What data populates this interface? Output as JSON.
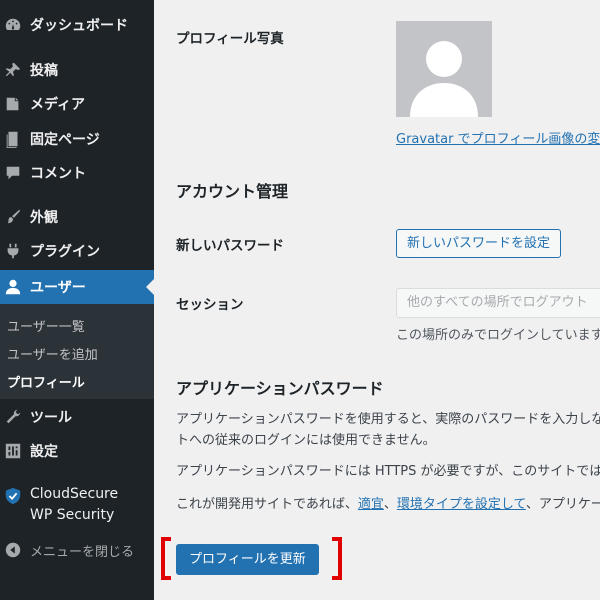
{
  "sidebar": {
    "items": [
      {
        "label": "ダッシュボード",
        "icon": "dashboard-icon"
      },
      {
        "label": "投稿",
        "icon": "pin-icon"
      },
      {
        "label": "メディア",
        "icon": "media-icon"
      },
      {
        "label": "固定ページ",
        "icon": "page-icon"
      },
      {
        "label": "コメント",
        "icon": "comment-icon"
      },
      {
        "label": "外観",
        "icon": "brush-icon"
      },
      {
        "label": "プラグイン",
        "icon": "plugin-icon"
      },
      {
        "label": "ユーザー",
        "icon": "user-icon"
      },
      {
        "label": "ツール",
        "icon": "wrench-icon"
      },
      {
        "label": "設定",
        "icon": "settings-icon"
      },
      {
        "label": "CloudSecure WP Security",
        "icon": "shield-icon"
      },
      {
        "label": "メニューを閉じる",
        "icon": "collapse-icon"
      }
    ],
    "submenu": [
      {
        "label": "ユーザー一覧"
      },
      {
        "label": "ユーザーを追加"
      },
      {
        "label": "プロフィール"
      }
    ]
  },
  "profile_photo": {
    "label": "プロフィール写真",
    "gravatar_link": "Gravatar でプロフィール画像の変更が可能です。"
  },
  "account": {
    "heading": "アカウント管理",
    "new_password_label": "新しいパスワード",
    "new_password_button": "新しいパスワードを設定",
    "session_label": "セッション",
    "logout_button": "他のすべての場所でログアウト",
    "session_desc": "この場所のみでログインしています。"
  },
  "app_passwords": {
    "heading": "アプリケーションパスワード",
    "para1_line1": "アプリケーションパスワードを使用すると、実際のパスワードを入力しなくても",
    "para1_line2": "トへの従来のログインには使用できません。",
    "para2": "アプリケーションパスワードには HTTPS が必要ですが、このサイトではそれ",
    "para3_prefix": "これが開発用サイトであれば、",
    "para3_link1": "適宜",
    "para3_sep": "、",
    "para3_link2": "環境タイプを設定して",
    "para3_suffix": "、アプリケーションパスワード"
  },
  "submit": {
    "label": "プロフィールを更新"
  },
  "colors": {
    "sidebar_bg": "#1d2327",
    "accent": "#2271b1",
    "highlight_bracket": "#e00000"
  }
}
